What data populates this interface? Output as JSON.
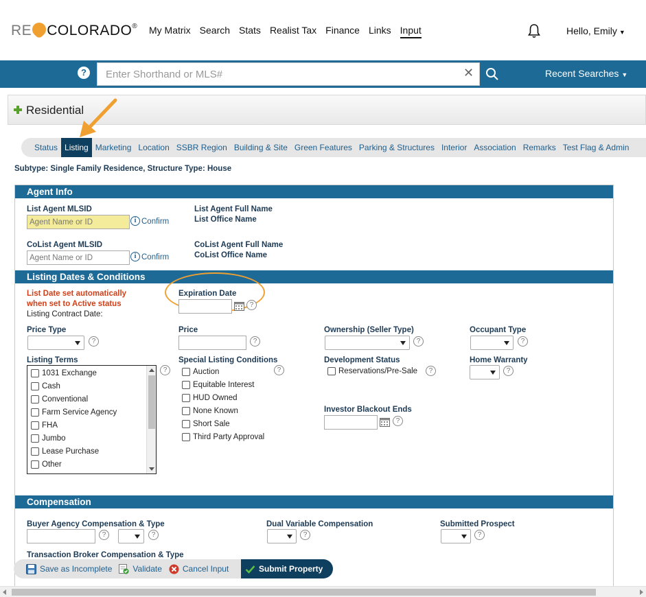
{
  "brand": {
    "logo_prefix": "RE",
    "logo_suffix": "COLORADO",
    "logo_mark": "®"
  },
  "nav": {
    "items": [
      "My Matrix",
      "Search",
      "Stats",
      "Realist Tax",
      "Finance",
      "Links",
      "Input"
    ],
    "active": "Input",
    "greeting": "Hello, Emily"
  },
  "search": {
    "placeholder": "Enter Shorthand or MLS#",
    "help": "?",
    "clear": "✕",
    "recent_label": "Recent Searches"
  },
  "page": {
    "title": "Residential"
  },
  "tabs": [
    "Status",
    "Listing",
    "Marketing",
    "Location",
    "SSBR Region",
    "Building & Site",
    "Green Features",
    "Parking & Structures",
    "Interior",
    "Association",
    "Remarks",
    "Test Flag & Admin"
  ],
  "active_tab": "Listing",
  "subtype": "Subtype: Single Family Residence, Structure Type: House",
  "agent_info": {
    "heading": "Agent Info",
    "list_agent_label": "List Agent MLSID",
    "list_agent_placeholder": "Agent Name or ID",
    "confirm_label": "Confirm",
    "list_agent_full_name": "List Agent Full Name",
    "list_office_name": "List Office Name",
    "colist_agent_label": "CoList Agent MLSID",
    "colist_agent_placeholder": "Agent Name or ID",
    "colist_agent_full_name": "CoList Agent Full Name",
    "colist_office_name": "CoList Office Name"
  },
  "listing_dates": {
    "heading": "Listing Dates & Conditions",
    "list_date_note_1": "List Date set automatically",
    "list_date_note_2": "when set to Active status",
    "contract_date_label": "Listing Contract Date:",
    "expiration_date_label": "Expiration Date",
    "price_type_label": "Price Type",
    "price_label": "Price",
    "ownership_label": "Ownership (Seller Type)",
    "occupant_label": "Occupant Type",
    "listing_terms_label": "Listing Terms",
    "listing_terms": [
      "1031 Exchange",
      "Cash",
      "Conventional",
      "Farm Service Agency",
      "FHA",
      "Jumbo",
      "Lease Purchase",
      "Other"
    ],
    "special_conditions_label": "Special Listing Conditions",
    "special_conditions": [
      "Auction",
      "Equitable Interest",
      "HUD Owned",
      "None Known",
      "Short Sale",
      "Third Party Approval"
    ],
    "development_status_label": "Development Status",
    "development_status": [
      "Reservations/Pre-Sale"
    ],
    "home_warranty_label": "Home Warranty",
    "investor_blackout_label": "Investor Blackout Ends"
  },
  "compensation": {
    "heading": "Compensation",
    "buyer_agency_label": "Buyer Agency Compensation & Type",
    "dual_variable_label": "Dual Variable Compensation",
    "submitted_prospect_label": "Submitted Prospect",
    "transaction_broker_label": "Transaction Broker Compensation & Type"
  },
  "actions": {
    "save_incomplete": "Save as Incomplete",
    "validate": "Validate",
    "cancel": "Cancel Input",
    "submit": "Submit Property"
  },
  "colors": {
    "brand_blue": "#1d6a96",
    "dark_navy": "#0f3f5f",
    "orange_accent": "#f0a030",
    "alert_red": "#d0401a",
    "agent_highlight": "#f4ec9a"
  }
}
